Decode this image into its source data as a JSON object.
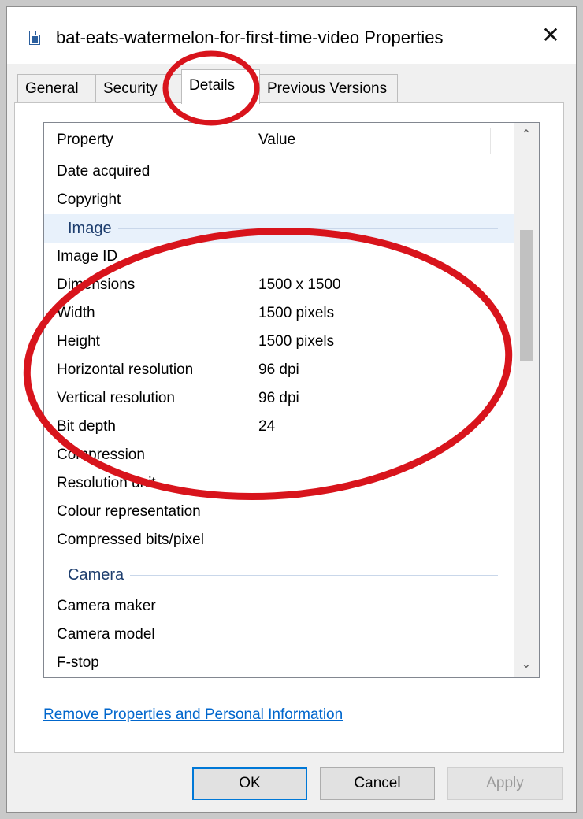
{
  "window": {
    "title": "bat-eats-watermelon-for-first-time-video Properties",
    "close_glyph": "✕"
  },
  "tabs": [
    {
      "label": "General"
    },
    {
      "label": "Security"
    },
    {
      "label": "Details"
    },
    {
      "label": "Previous Versions"
    }
  ],
  "active_tab": "Details",
  "details": {
    "columns": {
      "property": "Property",
      "value": "Value"
    },
    "rows_top": [
      {
        "property": "Date acquired",
        "value": ""
      },
      {
        "property": "Copyright",
        "value": ""
      }
    ],
    "group_image": "Image",
    "rows_image": [
      {
        "property": "Image ID",
        "value": ""
      },
      {
        "property": "Dimensions",
        "value": "1500 x 1500"
      },
      {
        "property": "Width",
        "value": "1500 pixels"
      },
      {
        "property": "Height",
        "value": "1500 pixels"
      },
      {
        "property": "Horizontal resolution",
        "value": "96 dpi"
      },
      {
        "property": "Vertical resolution",
        "value": "96 dpi"
      },
      {
        "property": "Bit depth",
        "value": "24"
      },
      {
        "property": "Compression",
        "value": ""
      },
      {
        "property": "Resolution unit",
        "value": ""
      },
      {
        "property": "Colour representation",
        "value": ""
      },
      {
        "property": "Compressed bits/pixel",
        "value": ""
      }
    ],
    "group_camera": "Camera",
    "rows_camera": [
      {
        "property": "Camera maker",
        "value": ""
      },
      {
        "property": "Camera model",
        "value": ""
      },
      {
        "property": "F-stop",
        "value": ""
      }
    ]
  },
  "scrollbar": {
    "up_glyph": "⌃",
    "down_glyph": "⌄"
  },
  "remove_link": "Remove Properties and Personal Information",
  "buttons": {
    "ok": "OK",
    "cancel": "Cancel",
    "apply": "Apply"
  },
  "annotation_color": "#d8141c"
}
